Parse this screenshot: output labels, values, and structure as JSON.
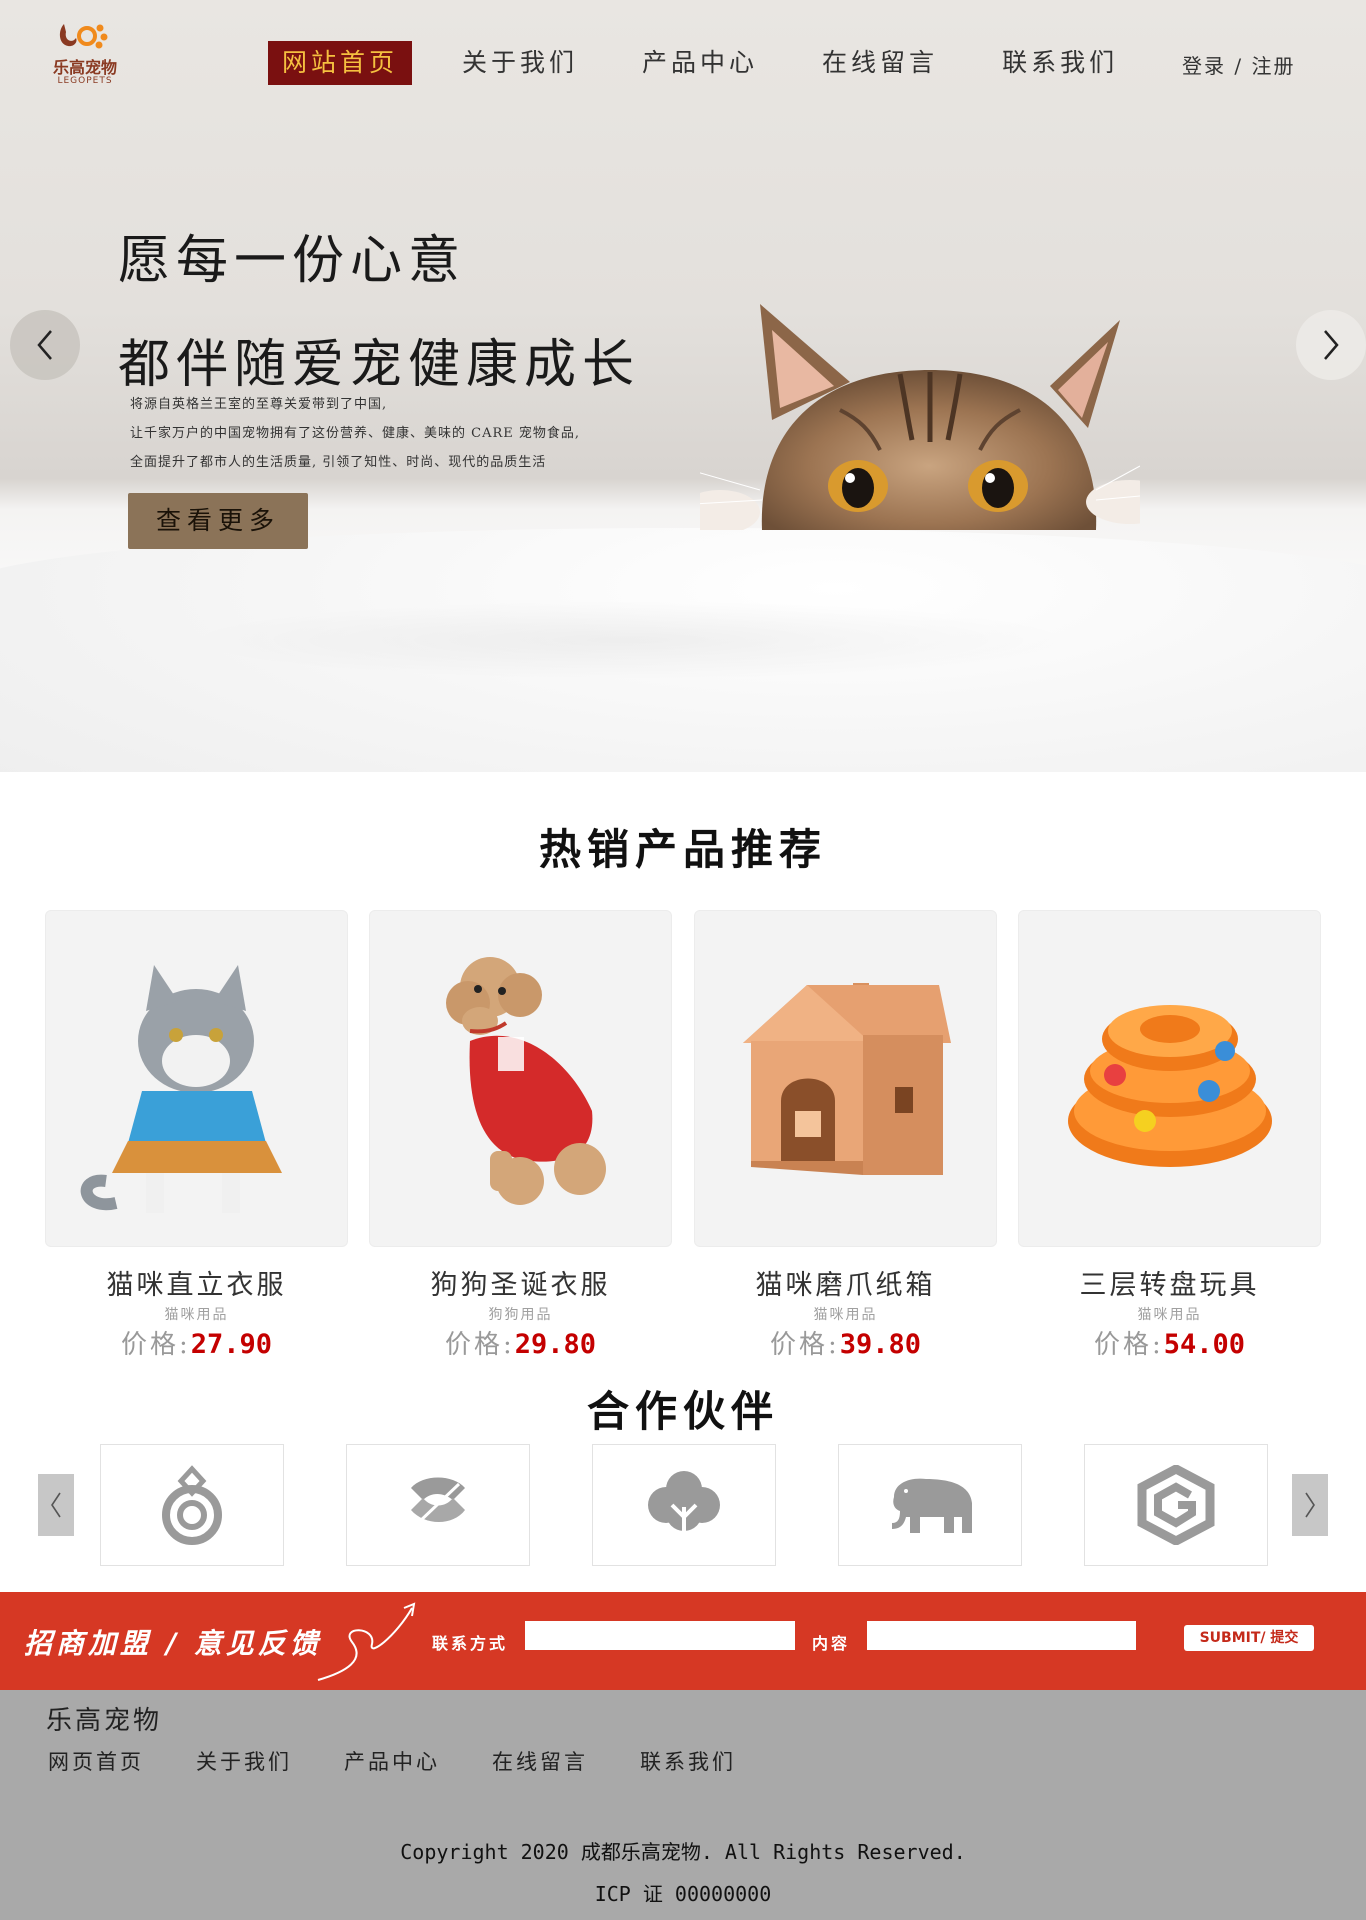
{
  "brand": {
    "name_cn": "乐高宠物",
    "name_en": "LEGOPETS",
    "accent": "#8a3a22",
    "logo_orange": "#f08a1c"
  },
  "nav": {
    "items": [
      {
        "label": "网站首页",
        "active": true
      },
      {
        "label": "关于我们",
        "active": false
      },
      {
        "label": "产品中心",
        "active": false
      },
      {
        "label": "在线留言",
        "active": false
      },
      {
        "label": "联系我们",
        "active": false
      }
    ],
    "active_bg": "#7a1010",
    "active_color": "#f5c040",
    "auth": "登录 / 注册"
  },
  "hero": {
    "title_line1": "愿每一份心意",
    "title_line2": "都伴随爱宠健康成长",
    "desc": [
      "将源自英格兰王室的至尊关爱带到了中国,",
      "让千家万户的中国宠物拥有了这份营养、健康、美味的 CARE 宠物食品,",
      "全面提升了都市人的生活质量, 引领了知性、时尚、现代的品质生活"
    ],
    "button": "查看更多",
    "prev_icon": "chevron-left-icon",
    "next_icon": "chevron-right-icon"
  },
  "hot": {
    "title": "热销产品推荐",
    "price_label": "价格:",
    "products": [
      {
        "name": "猫咪直立衣服",
        "category": "猫咪用品",
        "price": "27.90",
        "image": "cat-costume-image"
      },
      {
        "name": "狗狗圣诞衣服",
        "category": "狗狗用品",
        "price": "29.80",
        "image": "poodle-sweater-image"
      },
      {
        "name": "猫咪磨爪纸箱",
        "category": "猫咪用品",
        "price": "39.80",
        "image": "cardboard-house-image"
      },
      {
        "name": "三层转盘玩具",
        "category": "猫咪用品",
        "price": "54.00",
        "image": "turntable-toy-image"
      }
    ]
  },
  "partners": {
    "title": "合作伙伴",
    "logos": [
      "drop-logo",
      "ribbon-logo",
      "tree-logo",
      "elephant-logo",
      "hexagon-g-logo"
    ],
    "logo_color": "#9a9a9a"
  },
  "join": {
    "title": "招商加盟 / 意见反馈",
    "contact_label": "联系方式",
    "contact_value": "",
    "content_label": "内容",
    "content_value": "",
    "submit": "SUBMIT/ 提交",
    "bar_color": "#d63824"
  },
  "footer": {
    "brand": "乐高宠物",
    "links": [
      "网页首页",
      "关于我们",
      "产品中心",
      "在线留言",
      "联系我们"
    ],
    "copyright": "Copyright 2020 成都乐高宠物. All Rights Reserved.",
    "icp": "ICP 证 00000000"
  }
}
